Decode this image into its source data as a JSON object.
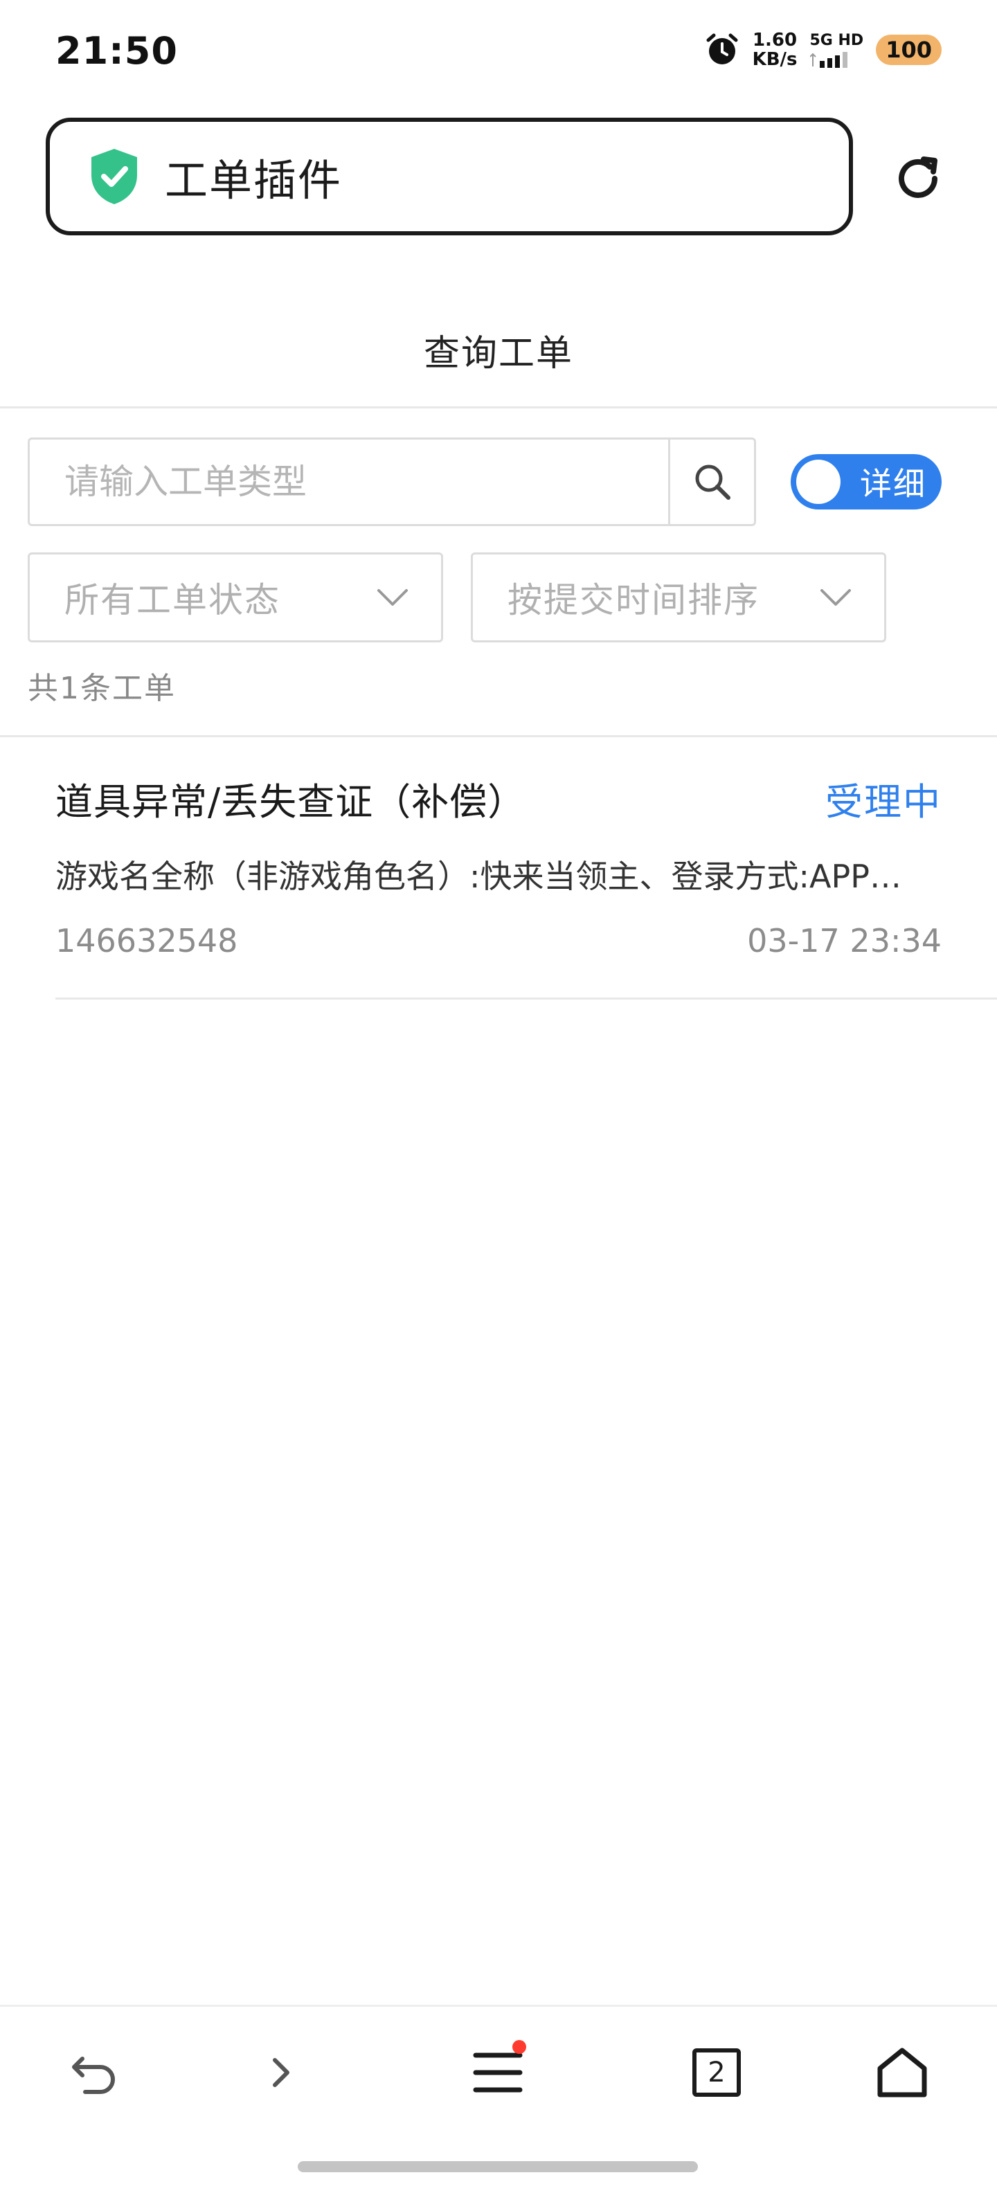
{
  "status_bar": {
    "time": "21:50",
    "net_speed_value": "1.60",
    "net_speed_unit": "KB/s",
    "network_label": "5G HD",
    "battery": "100",
    "icons": [
      "alarm-icon",
      "signal-icon"
    ]
  },
  "address_bar": {
    "title": "工单插件",
    "security_icon": "shield-check-icon",
    "security_color": "#34c28a",
    "reload_icon": "reload-icon"
  },
  "page": {
    "title": "查询工单"
  },
  "search": {
    "placeholder": "请输入工单类型",
    "value": "",
    "button_icon": "search-icon"
  },
  "toggle": {
    "label": "详细",
    "on": true,
    "color": "#2f80ed"
  },
  "filters": {
    "status_selected": "所有工单状态",
    "sort_selected": "按提交时间排序"
  },
  "result_count": "共1条工单",
  "tickets": [
    {
      "title": "道具异常/丢失查证（补偿）",
      "status": "受理中",
      "description": "游戏名全称（非游戏角色名）:快来当领主、登录方式:APP…",
      "id": "146632548",
      "time": "03-17 23:34"
    }
  ],
  "toolbar": {
    "tabs_count": "2",
    "icons": [
      "back-icon",
      "forward-icon",
      "menu-icon",
      "tabs-icon",
      "home-icon"
    ]
  }
}
